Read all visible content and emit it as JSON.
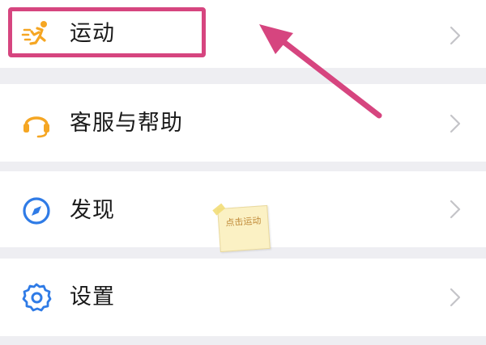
{
  "menu": {
    "items": [
      {
        "label": "运动",
        "icon": "running-person-icon"
      },
      {
        "label": "客服与帮助",
        "icon": "headset-icon"
      },
      {
        "label": "发现",
        "icon": "compass-icon"
      },
      {
        "label": "设置",
        "icon": "gear-icon"
      }
    ]
  },
  "annotation": {
    "note_text": "点击运动",
    "highlight_color": "#d6457f"
  },
  "colors": {
    "icon_accent": "#f5a623",
    "icon_blue": "#2f7be6",
    "chevron": "#c4c4c8",
    "background": "#eeeef2"
  }
}
